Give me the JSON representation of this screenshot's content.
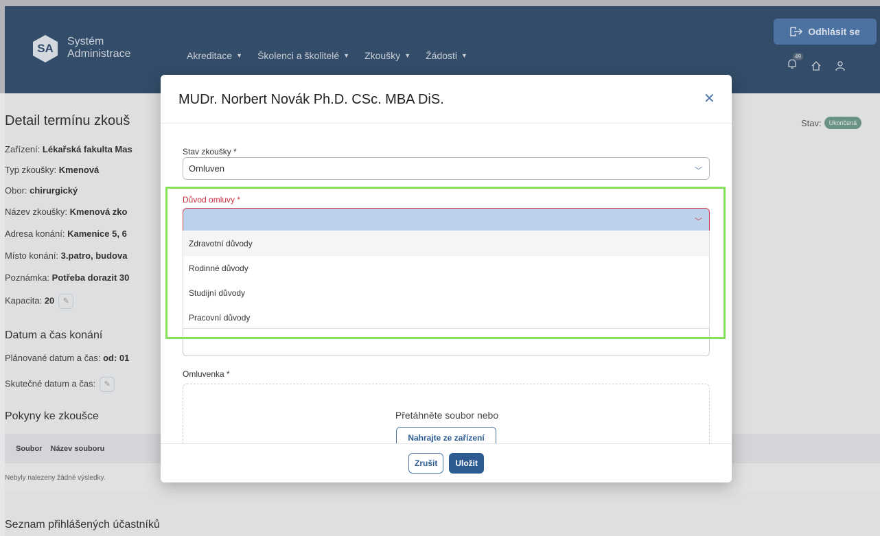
{
  "header": {
    "logo_text": "SA",
    "brand_line1": "Systém",
    "brand_line2": "Administrace",
    "nav": [
      "Akreditace",
      "Školenci a školitelé",
      "Zkoušky",
      "Žádosti"
    ],
    "logout_label": "Odhlásit se",
    "notification_count": "49"
  },
  "page": {
    "title": "Detail termínu zkouš",
    "status_label": "Stav:",
    "status_value": "Ukončená",
    "info": [
      {
        "label": "Zařízení:",
        "value": "Lékařská fakulta Mas"
      },
      {
        "label": "Typ zkoušky:",
        "value": "Kmenová"
      },
      {
        "label": "Obor:",
        "value": "chirurgický"
      },
      {
        "label": "Název zkoušky:",
        "value": "Kmenová zko"
      },
      {
        "label": "Adresa konání:",
        "value": "Kamenice 5, 6"
      },
      {
        "label": "Místo konání:",
        "value": "3.patro, budova"
      },
      {
        "label": "Poznámka:",
        "value": "Potřeba dorazit 30"
      },
      {
        "label": "Kapacita:",
        "value": "20"
      }
    ],
    "section_datetime": "Datum a čas konání",
    "planned_label": "Plánované datum a čas:",
    "planned_value": "od: 01",
    "actual_label": "Skutečné datum a čas:",
    "section_instructions": "Pokyny ke zkoušce",
    "table_cols": [
      "Soubor",
      "Název souboru"
    ],
    "table_empty": "Nebyly nalezeny žádné výsledky.",
    "section_participants": "Seznam přihlášených účastníků"
  },
  "modal": {
    "title": "MUDr. Norbert Novák Ph.D. CSc. MBA DiS.",
    "exam_state_label": "Stav zkoušky *",
    "exam_state_value": "Omluven",
    "reason_label": "Důvod omluvy *",
    "reason_value": "",
    "reason_options": [
      "Zdravotní důvody",
      "Rodinné důvody",
      "Studijní důvody",
      "Pracovní důvody"
    ],
    "excuse_label": "Omluvenka *",
    "dropzone_text": "Přetáhněte soubor nebo",
    "upload_label": "Nahrajte ze zařízení",
    "cancel_label": "Zrušit",
    "save_label": "Uložit"
  },
  "colors": {
    "header_bg": "#34506d",
    "accent": "#2d5c93",
    "error": "#d2424f",
    "highlight": "#82e05a"
  }
}
